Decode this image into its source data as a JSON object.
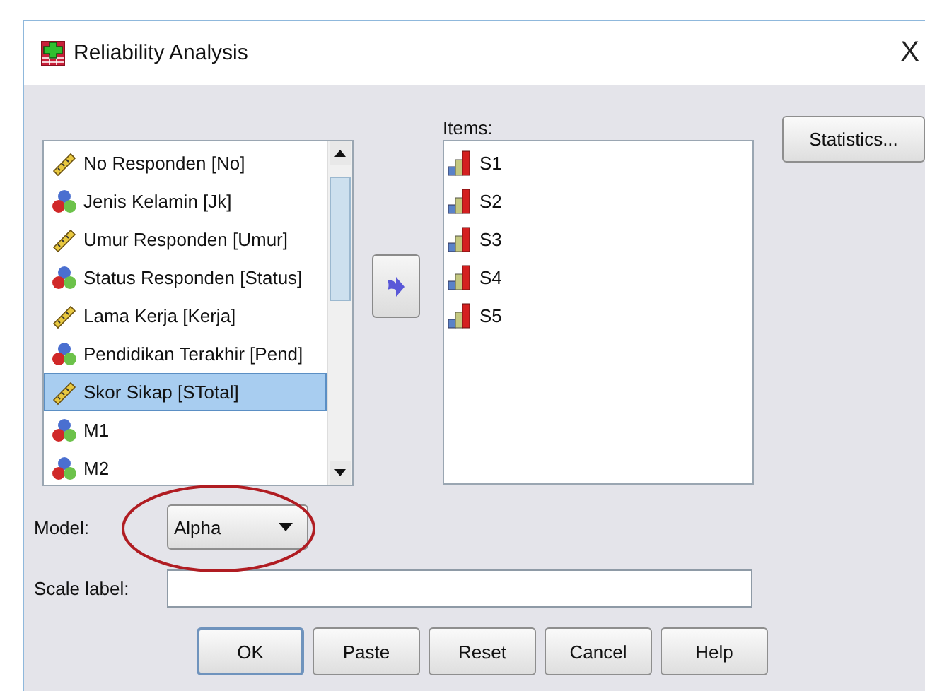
{
  "window": {
    "title": "Reliability Analysis",
    "close": "X"
  },
  "variables": {
    "items": [
      {
        "label": "No Responden [No]",
        "kind": "scale",
        "selected": false
      },
      {
        "label": "Jenis Kelamin [Jk]",
        "kind": "nominal",
        "selected": false
      },
      {
        "label": "Umur Responden [Umur]",
        "kind": "scale",
        "selected": false
      },
      {
        "label": "Status Responden [Status]",
        "kind": "nominal",
        "selected": false
      },
      {
        "label": "Lama Kerja [Kerja]",
        "kind": "scale",
        "selected": false
      },
      {
        "label": "Pendidikan Terakhir [Pend]",
        "kind": "nominal",
        "selected": false
      },
      {
        "label": "Skor Sikap [STotal]",
        "kind": "scale",
        "selected": true
      },
      {
        "label": "M1",
        "kind": "nominal",
        "selected": false
      },
      {
        "label": "M2",
        "kind": "nominal",
        "selected": false
      }
    ]
  },
  "items": {
    "label": "Items:",
    "items": [
      {
        "label": "S1",
        "kind": "ordinal"
      },
      {
        "label": "S2",
        "kind": "ordinal"
      },
      {
        "label": "S3",
        "kind": "ordinal"
      },
      {
        "label": "S4",
        "kind": "ordinal"
      },
      {
        "label": "S5",
        "kind": "ordinal"
      }
    ]
  },
  "statistics_button": "Statistics...",
  "model": {
    "label": "Model:",
    "value": "Alpha",
    "highlighted": true
  },
  "scale_label": {
    "label": "Scale label:"
  },
  "buttons": [
    {
      "label": "OK",
      "default": true
    },
    {
      "label": "Paste",
      "default": false
    },
    {
      "label": "Reset",
      "default": false
    },
    {
      "label": "Cancel",
      "default": false
    },
    {
      "label": "Help",
      "default": false
    }
  ]
}
